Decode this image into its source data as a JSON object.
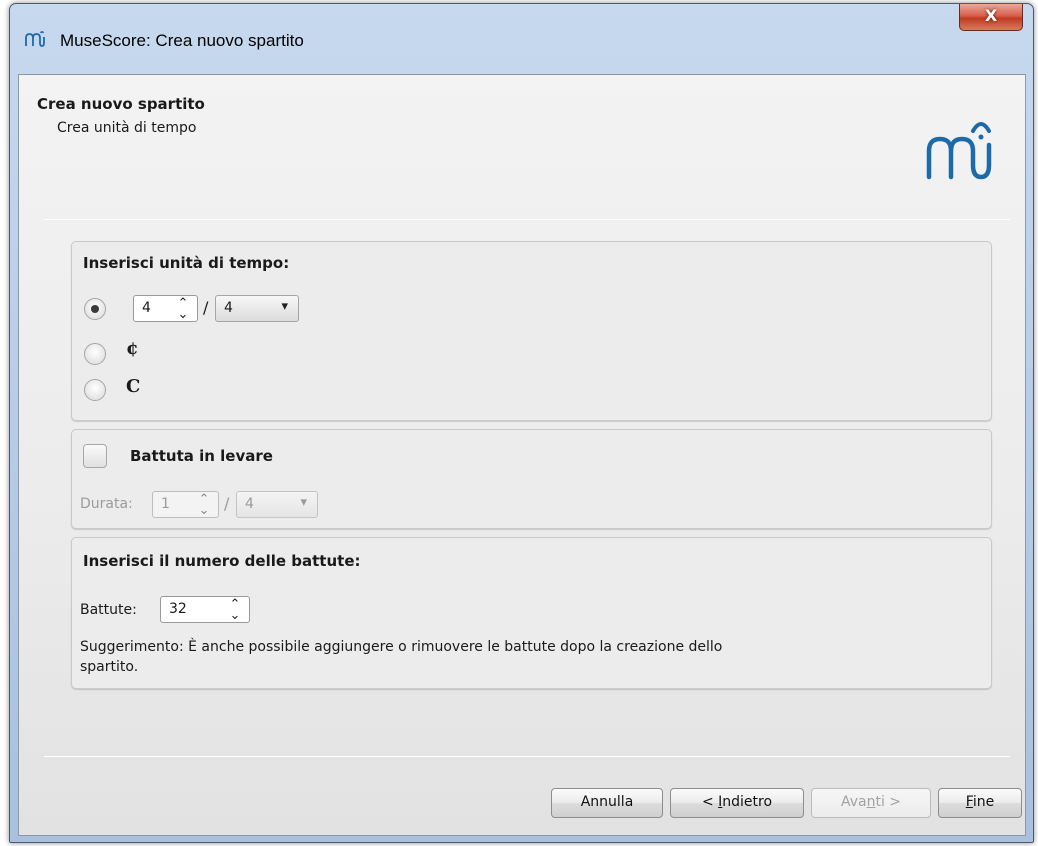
{
  "window": {
    "title": "MuseScore: Crea nuovo spartito",
    "close_label": "X"
  },
  "header": {
    "title": "Crea nuovo spartito",
    "subtitle": "Crea unità di tempo",
    "logo_icon": "musescore-logo-icon"
  },
  "time_signature": {
    "title": "Inserisci unità di tempo:",
    "numerator": "4",
    "denominator": "4",
    "slash": "/",
    "cut_time_symbol": "¢",
    "common_time_symbol": "C",
    "selected_option": "numeric"
  },
  "pickup": {
    "label": "Battuta in levare",
    "checked": false,
    "duration_label": "Durata:",
    "numerator": "1",
    "denominator": "4",
    "slash": "/"
  },
  "measures": {
    "title": "Inserisci il numero delle  battute:",
    "label": "Battute:",
    "value": "32",
    "hint_line1": "Suggerimento: È anche possibile aggiungere o rimuovere le battute dopo la creazione dello",
    "hint_line2": "spartito."
  },
  "buttons": {
    "cancel_label": "Annulla",
    "back_prefix": "< ",
    "back_mnemonic": "I",
    "back_rest": "ndietro",
    "next_prefix": "Ava",
    "next_mnemonic": "n",
    "next_rest": "ti >",
    "finish_mnemonic": "F",
    "finish_rest": "ine"
  },
  "colors": {
    "logo_blue": "#1c6aa8",
    "title_bar": "#b9cde6",
    "close_button": "#c03a22"
  }
}
